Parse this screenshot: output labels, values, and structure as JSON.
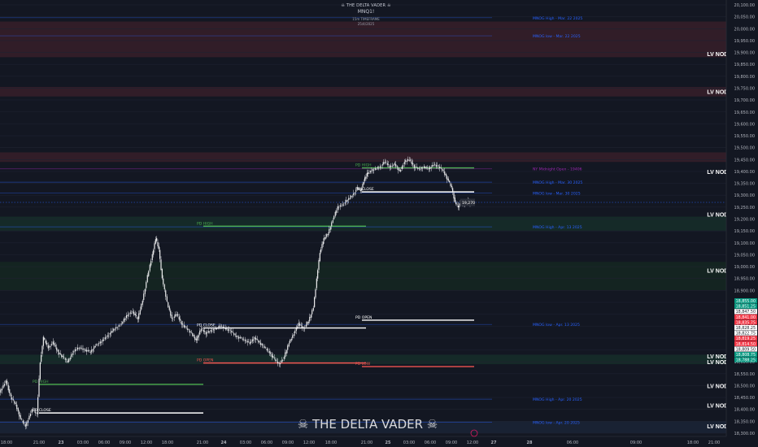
{
  "header": {
    "brand": "☠ THE DELTA VADER ☠",
    "symbol": "MNQ1!",
    "timeframe": "15m TIMEFRAME",
    "date": "25/4/2025"
  },
  "watermark": "☠ THE DELTA VADER ☠",
  "colors": {
    "background": "#131722",
    "up": "#ffffff",
    "down": "#ffffff",
    "axis_text": "#b2b5be",
    "level_green": "#4caf50",
    "level_red": "#ef5350",
    "level_white": "#ffffff",
    "level_blue": "#2962ff",
    "mnog_label": "#3d6fd6",
    "midnight": "#9c27b0"
  },
  "chart_data": {
    "type": "candlestick",
    "title": "",
    "ylim": [
      18300,
      20100
    ],
    "yaxis": {
      "ticks": [
        "18,300.00",
        "18,350.00",
        "18,400.00",
        "18,450.00",
        "18,500.00",
        "18,550.00",
        "18,600.00",
        "18,650.00",
        "18,700.00",
        "18,750.00",
        "18,800.00",
        "18,850.00",
        "18,900.00",
        "18,950.00",
        "19,000.00",
        "19,050.00",
        "19,100.00",
        "19,150.00",
        "19,200.00",
        "19,250.00",
        "19,300.00",
        "19,350.00",
        "19,400.00",
        "19,450.00",
        "19,500.00",
        "19,550.00",
        "19,600.00",
        "19,650.00",
        "19,700.00",
        "19,750.00",
        "19,800.00",
        "19,850.00",
        "19,900.00",
        "19,950.00",
        "20,000.00",
        "20,050.00",
        "20,100.00"
      ],
      "tick_values": [
        18300,
        18350,
        18400,
        18450,
        18500,
        18550,
        18600,
        18650,
        18700,
        18750,
        18800,
        18850,
        18900,
        18950,
        19000,
        19050,
        19100,
        19150,
        19200,
        19250,
        19300,
        19350,
        19400,
        19450,
        19500,
        19550,
        19600,
        19650,
        19700,
        19750,
        19800,
        19850,
        19900,
        19950,
        20000,
        20050,
        20100
      ]
    },
    "xaxis": {
      "labels": [
        "18:00",
        "21:00",
        "23",
        "03:00",
        "06:00",
        "09:00",
        "12:00",
        "18:00",
        "21:00",
        "24",
        "03:00",
        "06:00",
        "09:00",
        "12:00",
        "18:00",
        "21:00",
        "25",
        "03:00",
        "06:00",
        "09:00",
        "12:00",
        "27",
        "28",
        "06:00",
        "09:00",
        "18:00",
        "21:00"
      ],
      "bold": [
        "23",
        "24",
        "25",
        "27",
        "28"
      ]
    },
    "price_tags": [
      {
        "value": 18855.0,
        "text": "18,855.00",
        "color": "#089981"
      },
      {
        "value": 18851.25,
        "text": "18,851.25",
        "color": "#089981"
      },
      {
        "value": 18847.5,
        "text": "18,847.50",
        "color": "#ffffff"
      },
      {
        "value": 18841.0,
        "text": "18,841.00",
        "color": "#f23645"
      },
      {
        "value": 18835.75,
        "text": "18,835.75",
        "color": "#f23645"
      },
      {
        "value": 18828.25,
        "text": "18,828.25",
        "color": "#ffffff"
      },
      {
        "value": 18822.75,
        "text": "18,822.75",
        "color": "#ffffff"
      },
      {
        "value": 18819.25,
        "text": "18,819.25",
        "color": "#f23645"
      },
      {
        "value": 18814.5,
        "text": "18,814.50",
        "color": "#f23645"
      },
      {
        "value": 18809.5,
        "text": "18,809.50",
        "color": "#ffffff"
      },
      {
        "value": 18808.75,
        "text": "18,808.75",
        "color": "#089981"
      },
      {
        "value": 18788.25,
        "text": "18,788.25",
        "color": "#089981"
      }
    ],
    "zones": [
      {
        "from": 19880,
        "to": 20030,
        "color": "#3a1f2a"
      },
      {
        "from": 19715,
        "to": 19755,
        "color": "#3a1f2a"
      },
      {
        "from": 19440,
        "to": 19480,
        "color": "#3a1f2a"
      },
      {
        "from": 19150,
        "to": 19210,
        "color": "#16302a"
      },
      {
        "from": 18900,
        "to": 19020,
        "color": "#152822"
      },
      {
        "from": 18590,
        "to": 18630,
        "color": "#16302a"
      },
      {
        "from": 18300,
        "to": 18350,
        "color": "#1b2538"
      }
    ],
    "lv_nodes": [
      {
        "value": 19895,
        "text": "LV NODE"
      },
      {
        "value": 19737,
        "text": "LV NODE"
      },
      {
        "value": 19400,
        "text": "LV NODE"
      },
      {
        "value": 19220,
        "text": "LV NODE"
      },
      {
        "value": 18985,
        "text": "LV NODE"
      },
      {
        "value": 18625,
        "text": "LV NODE"
      },
      {
        "value": 18600,
        "text": "LV NODE"
      },
      {
        "value": 18500,
        "text": "LV NODE"
      },
      {
        "value": 18417,
        "text": "LV NODE"
      },
      {
        "value": 18330,
        "text": "LV NODE"
      }
    ],
    "levels": [
      {
        "value": 20046,
        "text": "MNOG High - Mar. 22 2025",
        "color": "#2962ff"
      },
      {
        "value": 19970,
        "text": "MNOG low - Mar. 22 2025",
        "color": "#2962ff"
      },
      {
        "value": 19355,
        "text": "MNOG High - Mar. 30 2025",
        "color": "#2962ff"
      },
      {
        "value": 19310,
        "text": "MNOG low - Mar. 30 2025",
        "color": "#2962ff"
      },
      {
        "value": 19167,
        "text": "MNOG High - Apr. 13 2025",
        "color": "#2962ff"
      },
      {
        "value": 18757,
        "text": "MNOG low - Apr. 13 2025",
        "color": "#2962ff"
      },
      {
        "value": 18443,
        "text": "MNOG High - Apr. 20 2025",
        "color": "#2962ff"
      },
      {
        "value": 18346,
        "text": "MNOG low - Apr. 20 2025",
        "color": "#2962ff"
      },
      {
        "value": 19411,
        "text": "NY Midnight Open - 19406",
        "color": "#9c27b0"
      }
    ],
    "pd_levels": [
      {
        "text": "PD HIGH",
        "value": 19415,
        "x1": 445,
        "x2": 583,
        "color": "#4caf50"
      },
      {
        "text": "PD CLOSE",
        "value": 19314,
        "x1": 445,
        "x2": 583,
        "color": "#ffffff"
      },
      {
        "text": "PD OPEN",
        "value": 18775,
        "x1": 445,
        "x2": 583,
        "color": "#ffffff"
      },
      {
        "text": "PD LOW",
        "value": 18580,
        "x1": 445,
        "x2": 583,
        "color": "#ef5350"
      },
      {
        "text": "PD HIGH",
        "value": 19170,
        "x1": 250,
        "x2": 450,
        "color": "#4caf50"
      },
      {
        "text": "PD CLOSE",
        "value": 18742,
        "x1": 250,
        "x2": 450,
        "color": "#ffffff"
      },
      {
        "text": "PD OPEN",
        "value": 18595,
        "x1": 250,
        "x2": 450,
        "color": "#ef5350"
      },
      {
        "text": "PD HIGH",
        "value": 18505,
        "x1": 48,
        "x2": 250,
        "color": "#4caf50"
      },
      {
        "text": "PD CLOSE",
        "value": 18385,
        "x1": 48,
        "x2": 250,
        "color": "#ffffff"
      }
    ],
    "current_price": {
      "value": 19270,
      "text": "19,270"
    },
    "series_path": [
      [
        0,
        18470
      ],
      [
        8,
        18520
      ],
      [
        14,
        18450
      ],
      [
        20,
        18420
      ],
      [
        26,
        18360
      ],
      [
        32,
        18330
      ],
      [
        40,
        18400
      ],
      [
        46,
        18380
      ],
      [
        50,
        18600
      ],
      [
        54,
        18700
      ],
      [
        60,
        18660
      ],
      [
        66,
        18680
      ],
      [
        72,
        18640
      ],
      [
        78,
        18620
      ],
      [
        84,
        18600
      ],
      [
        90,
        18640
      ],
      [
        98,
        18660
      ],
      [
        106,
        18650
      ],
      [
        112,
        18640
      ],
      [
        118,
        18670
      ],
      [
        124,
        18680
      ],
      [
        130,
        18700
      ],
      [
        136,
        18720
      ],
      [
        142,
        18740
      ],
      [
        150,
        18760
      ],
      [
        158,
        18800
      ],
      [
        164,
        18810
      ],
      [
        170,
        18780
      ],
      [
        176,
        18860
      ],
      [
        182,
        18960
      ],
      [
        188,
        19050
      ],
      [
        192,
        19120
      ],
      [
        196,
        19070
      ],
      [
        200,
        18950
      ],
      [
        206,
        18850
      ],
      [
        212,
        18780
      ],
      [
        218,
        18800
      ],
      [
        224,
        18760
      ],
      [
        230,
        18740
      ],
      [
        236,
        18720
      ],
      [
        242,
        18690
      ],
      [
        248,
        18740
      ],
      [
        254,
        18720
      ],
      [
        260,
        18730
      ],
      [
        266,
        18740
      ],
      [
        272,
        18750
      ],
      [
        278,
        18740
      ],
      [
        284,
        18730
      ],
      [
        290,
        18710
      ],
      [
        296,
        18700
      ],
      [
        302,
        18690
      ],
      [
        308,
        18680
      ],
      [
        314,
        18700
      ],
      [
        320,
        18680
      ],
      [
        326,
        18660
      ],
      [
        332,
        18640
      ],
      [
        338,
        18610
      ],
      [
        344,
        18590
      ],
      [
        350,
        18620
      ],
      [
        356,
        18680
      ],
      [
        362,
        18720
      ],
      [
        368,
        18760
      ],
      [
        374,
        18740
      ],
      [
        380,
        18770
      ],
      [
        386,
        18830
      ],
      [
        390,
        18950
      ],
      [
        394,
        19060
      ],
      [
        398,
        19110
      ],
      [
        404,
        19140
      ],
      [
        410,
        19200
      ],
      [
        416,
        19250
      ],
      [
        422,
        19260
      ],
      [
        428,
        19280
      ],
      [
        434,
        19300
      ],
      [
        440,
        19330
      ],
      [
        444,
        19320
      ],
      [
        448,
        19360
      ],
      [
        452,
        19390
      ],
      [
        456,
        19400
      ],
      [
        462,
        19410
      ],
      [
        468,
        19420
      ],
      [
        474,
        19440
      ],
      [
        480,
        19420
      ],
      [
        486,
        19430
      ],
      [
        492,
        19400
      ],
      [
        498,
        19440
      ],
      [
        504,
        19450
      ],
      [
        510,
        19420
      ],
      [
        516,
        19410
      ],
      [
        522,
        19420
      ],
      [
        528,
        19410
      ],
      [
        534,
        19430
      ],
      [
        540,
        19420
      ],
      [
        546,
        19400
      ],
      [
        552,
        19360
      ],
      [
        556,
        19330
      ],
      [
        560,
        19270
      ],
      [
        564,
        19250
      ],
      [
        568,
        19270
      ],
      [
        572,
        19260
      ],
      [
        576,
        19280
      ],
      [
        580,
        19265
      ],
      [
        584,
        19270
      ]
    ]
  }
}
